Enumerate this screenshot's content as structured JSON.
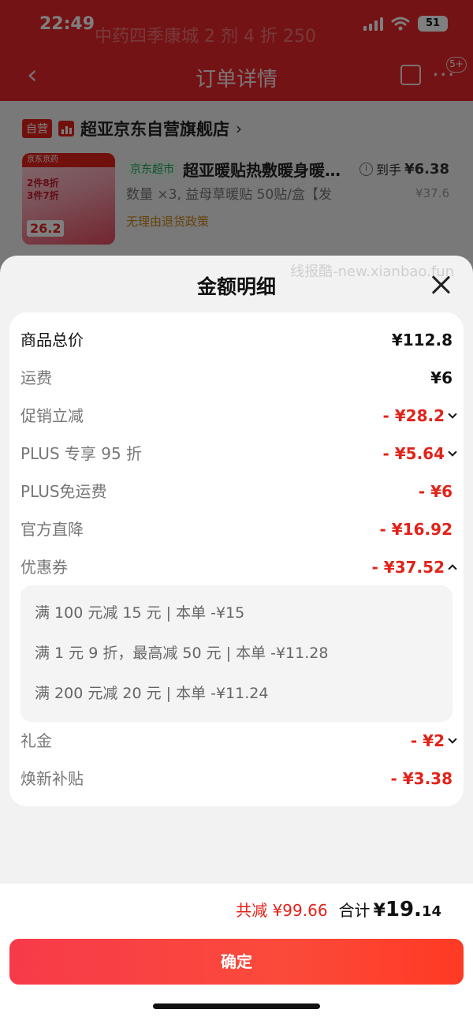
{
  "status_bar": {
    "time": "22:49",
    "battery": "51"
  },
  "header": {
    "banner_text": "中药四季康城 2 剂 4 折 250",
    "title": "订单详情",
    "badge": "5+"
  },
  "store": {
    "tag": "自营",
    "name": "超亚京东自营旗舰店"
  },
  "product": {
    "image_top_label": "京东京药",
    "image_text_1": "2件8折",
    "image_text_2": "3件7折",
    "image_price": "26.2",
    "market_tag": "京东超市",
    "title": "超亚暖贴热敷暖身暖…",
    "spec": "数量 ×3, 益母草暖贴 50贴/盒【发",
    "policy": "无理由退货政策",
    "hand_price_label": "到手",
    "hand_price": "¥6.38",
    "original_price": "¥37.6"
  },
  "sheet": {
    "watermark": "线报酷-new.xianbao.fun",
    "title": "金额明细",
    "rows": [
      {
        "label": "商品总价",
        "value": "¥112.8"
      },
      {
        "label": "运费",
        "value": "¥6"
      },
      {
        "label": "促销立减",
        "value": "- ¥28.2"
      },
      {
        "label": "PLUS 专享 95 折",
        "value": "- ¥5.64"
      },
      {
        "label": "PLUS免运费",
        "value": "- ¥6"
      },
      {
        "label": "官方直降",
        "value": "- ¥16.92"
      },
      {
        "label": "优惠券",
        "value": "- ¥37.52"
      },
      {
        "label": "礼金",
        "value": "- ¥2"
      },
      {
        "label": "焕新补贴",
        "value": "- ¥3.38"
      }
    ],
    "coupons": [
      "满 100 元减 15 元 | 本单 -¥15",
      "满 1 元 9 折，最高减 50 元 | 本单 -¥11.28",
      "满 200 元减 20 元 | 本单 -¥11.24"
    ]
  },
  "footer": {
    "saved": "共减 ¥99.66",
    "total_label": "合计",
    "total_yen": "¥",
    "total_int": "19.",
    "total_dec": "14",
    "confirm_label": "确定"
  },
  "colors": {
    "brand_red": "#e2231a",
    "header_red": "#e8272b",
    "market_green": "#1aa35a",
    "policy_orange": "#c8871a"
  }
}
